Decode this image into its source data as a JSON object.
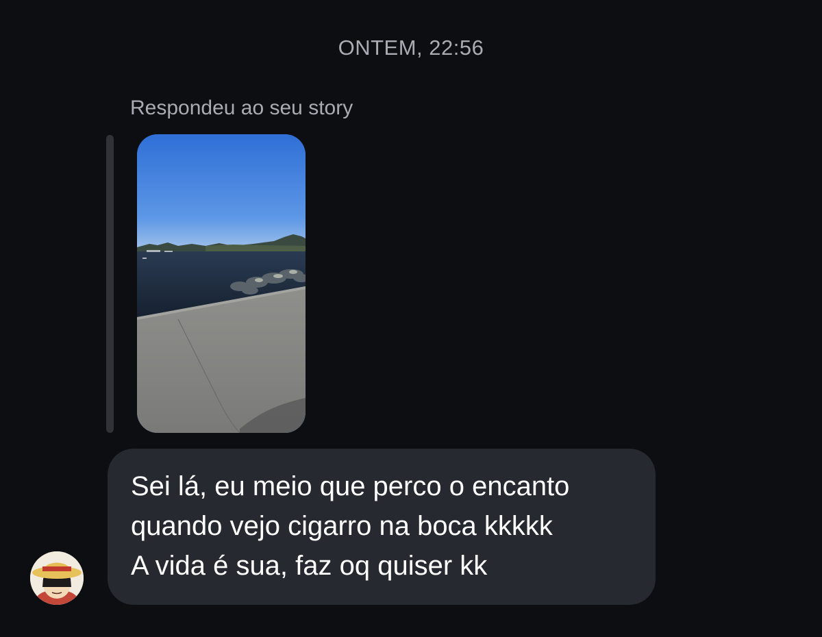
{
  "chat": {
    "timestamp": "ONTEM, 22:56",
    "reply_label": "Respondeu ao seu story",
    "story": {
      "kind": "photo",
      "subject": "seaside-pier"
    },
    "message": {
      "lines": [
        "Sei lá, eu meio que perco o encanto",
        "quando vejo cigarro na boca kkkkk",
        "A vida é sua, faz oq quiser kk"
      ]
    },
    "avatar": {
      "icon": "straw-hat-character-icon"
    }
  },
  "colors": {
    "background": "#0c0e12",
    "bubble": "#262a30",
    "muted_text": "#a9acb3",
    "message_text": "#ffffff",
    "reply_bar": "#303237"
  }
}
